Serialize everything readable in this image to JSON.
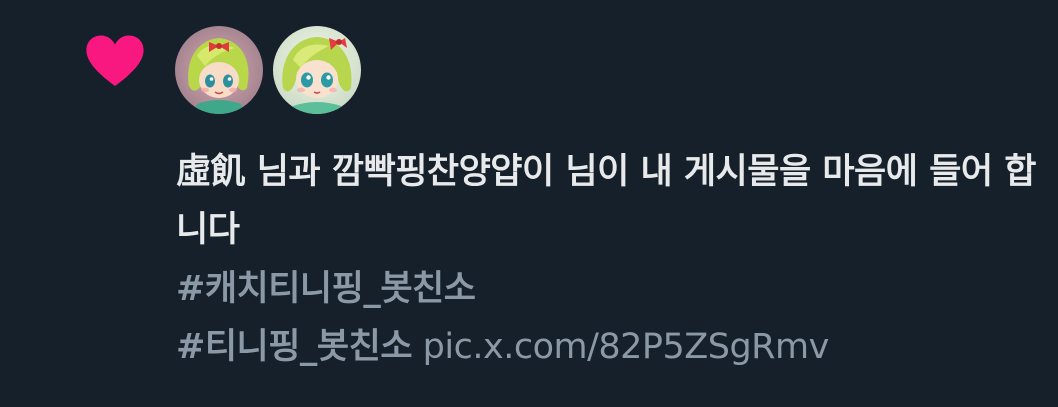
{
  "notification": {
    "type": "like",
    "icon": "heart-icon",
    "icon_color": "#f91880",
    "avatars": [
      {
        "name": "avatar-user-1",
        "desc": "green-haired doll character with red bow"
      },
      {
        "name": "avatar-user-2",
        "desc": "green-haired doll character with red bow"
      }
    ],
    "user1": "虛飢",
    "mid1": " 님과 ",
    "user2": "깜빡핑찬양얍이",
    "suffix": " 님이 내 게시물을 마음에 들어 합니다"
  },
  "tweet": {
    "hashtag1": "#캐치티니핑_봇친소",
    "hashtag2": "#티니핑_봇친소",
    "link": "pic.x.com/82P5ZSgRmv"
  },
  "colors": {
    "background": "#15202b",
    "text_primary": "#e7e9ea",
    "text_secondary": "#8b98a5",
    "like": "#f91880"
  }
}
